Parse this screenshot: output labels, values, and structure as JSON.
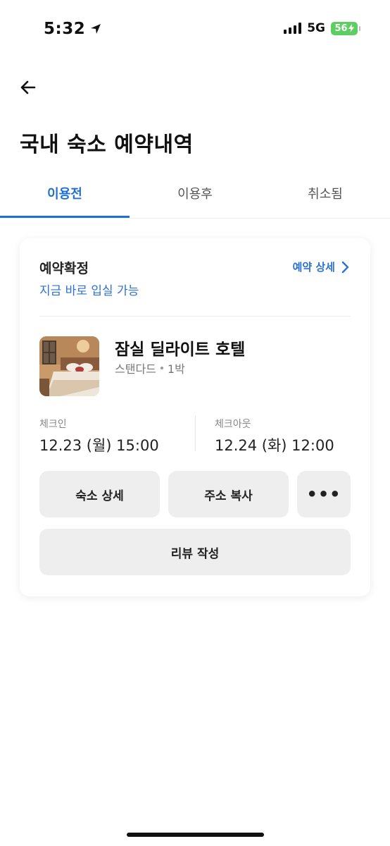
{
  "status_bar": {
    "time": "5:32",
    "network": "5G",
    "battery": "56"
  },
  "header": {
    "back_icon": "arrow-left-icon",
    "title": "국내 숙소 예약내역"
  },
  "tabs": [
    {
      "label": "이용전",
      "active": true
    },
    {
      "label": "이용후",
      "active": false
    },
    {
      "label": "취소됨",
      "active": false
    }
  ],
  "colors": {
    "accent": "#1f6fd1",
    "button_bg": "#eeeeee"
  },
  "reservation": {
    "status": "예약확정",
    "status_sub": "지금 바로 입실 가능",
    "detail_link": "예약 상세",
    "hotel_name": "잠실 딜라이트 호텔",
    "room_type": "스탠다드",
    "nights": "1박",
    "checkin_label": "체크인",
    "checkin_value": "12.23 (월) 15:00",
    "checkout_label": "체크아웃",
    "checkout_value": "12.24 (화) 12:00"
  },
  "actions": {
    "hotel_detail": "숙소 상세",
    "copy_address": "주소 복사",
    "more": "•••",
    "write_review": "리뷰 작성"
  }
}
